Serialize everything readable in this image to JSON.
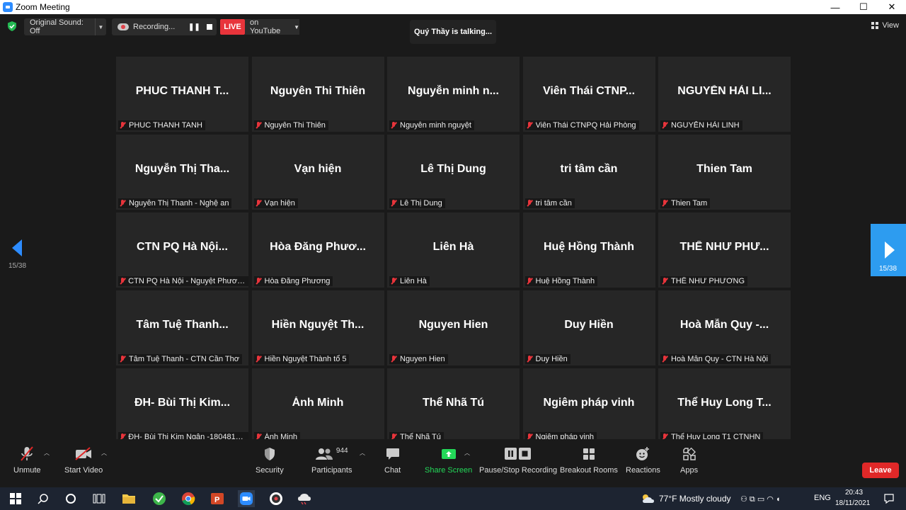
{
  "window": {
    "title": "Zoom Meeting",
    "minimize": "—",
    "maximize": "☐",
    "close": "✕"
  },
  "topbar": {
    "original_sound": "Original Sound: Off",
    "recording": "Recording...",
    "live": "LIVE",
    "live_target": "on YouTube",
    "talking": "Quý Thầy is talking...",
    "view": "View"
  },
  "pagination": {
    "left_page": "15/38",
    "right_page": "15/38"
  },
  "participants": [
    {
      "display": "PHUC THANH T...",
      "name": "PHUC THANH TANH"
    },
    {
      "display": "Nguyên Thi Thiên",
      "name": "Nguyên Thi Thiên"
    },
    {
      "display": "Nguyễn minh n...",
      "name": "Nguyễn minh nguyệt"
    },
    {
      "display": "Viên Thái CTNP...",
      "name": "Viên Thái CTNPQ Hải Phòng"
    },
    {
      "display": "NGUYỄN HẢI LI...",
      "name": "NGUYỄN HẢI LINH"
    },
    {
      "display": "Nguyễn Thị Tha...",
      "name": "Nguyễn Thị Thanh  -  Nghệ an"
    },
    {
      "display": "Vạn hiện",
      "name": "Vạn hiện"
    },
    {
      "display": "Lê Thị Dung",
      "name": "Lê Thị Dung"
    },
    {
      "display": "tri tâm cần",
      "name": "tri tâm cần"
    },
    {
      "display": "Thien Tam",
      "name": "Thien Tam"
    },
    {
      "display": "CTN PQ Hà Nội...",
      "name": "CTN PQ Hà Nội - Nguyệt Phương ..."
    },
    {
      "display": "Hòa Đăng Phươ...",
      "name": "Hòa Đăng Phương"
    },
    {
      "display": "Liên Hà",
      "name": "Liên Hà"
    },
    {
      "display": "Huệ Hồng Thành",
      "name": "Huệ Hồng Thành"
    },
    {
      "display": "THỂ NHƯ PHƯ...",
      "name": "THỂ NHƯ PHƯƠNG"
    },
    {
      "display": "Tâm Tuệ Thanh...",
      "name": "Tâm Tuệ Thanh - CTN Cần Thơ"
    },
    {
      "display": "Hiền Nguyệt Th...",
      "name": "Hiền Nguyệt Thành tổ 5"
    },
    {
      "display": "Nguyen Hien",
      "name": "Nguyen Hien"
    },
    {
      "display": "Duy Hiền",
      "name": "Duy Hiền"
    },
    {
      "display": "Hoà Mẫn Quy -...",
      "name": "Hoà Mẫn Quy - CTN Hà Nội"
    },
    {
      "display": "ĐH- Bùi Thị Kim...",
      "name": "ĐH- Bùi Thị Kim Ngân -18048151 ..."
    },
    {
      "display": "Ánh Minh",
      "name": "Ánh Minh"
    },
    {
      "display": "Thể Nhã Tú",
      "name": "Thể Nhã Tú"
    },
    {
      "display": "Ngiêm pháp vinh",
      "name": "Ngiêm pháp vinh"
    },
    {
      "display": "Thể Huy Long T...",
      "name": "Thể Huy Long T1 CTNHN"
    }
  ],
  "toolbar": {
    "unmute": "Unmute",
    "start_video": "Start Video",
    "security": "Security",
    "participants": "Participants",
    "participants_count": "944",
    "chat": "Chat",
    "share_screen": "Share Screen",
    "pause_stop_recording": "Pause/Stop Recording",
    "breakout_rooms": "Breakout Rooms",
    "reactions": "Reactions",
    "apps": "Apps",
    "leave": "Leave"
  },
  "taskbar": {
    "weather": "77°F  Mostly cloudy",
    "language": "ENG",
    "time": "20:43",
    "date": "18/11/2021"
  },
  "colors": {
    "accent": "#2d8cff",
    "live_red": "#e8343b",
    "leave_red": "#e02828",
    "share_green": "#23d959",
    "background": "#1a1a1a",
    "tile": "#262626"
  }
}
